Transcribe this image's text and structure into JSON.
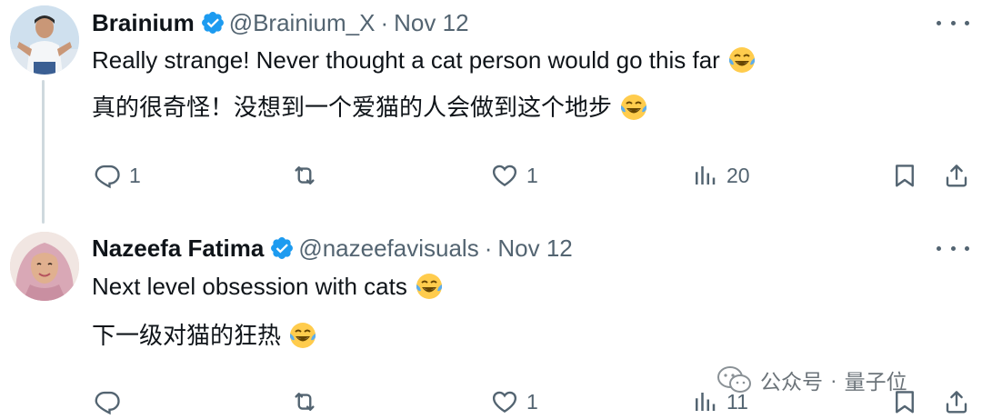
{
  "tweets": [
    {
      "author": "Brainium",
      "handle": "@Brainium_X",
      "separator": "·",
      "date": "Nov 12",
      "text_en": "Really strange! Never thought a cat person would go this far",
      "text_zh": "真的很奇怪！没想到一个爱猫的人会做到这个地步",
      "stats": {
        "replies": "1",
        "retweets": "",
        "likes": "1",
        "views": "20"
      }
    },
    {
      "author": "Nazeefa Fatima",
      "handle": "@nazeefavisuals",
      "separator": "·",
      "date": "Nov 12",
      "text_en": "Next level obsession with cats",
      "text_zh": "下一级对猫的狂热",
      "stats": {
        "replies": "",
        "retweets": "",
        "likes": "1",
        "views": "11"
      }
    }
  ],
  "watermark": {
    "source": "公众号",
    "separator": "·",
    "account": "量子位"
  },
  "icons": {
    "verified": "verified-badge-icon",
    "more": "more-options-icon",
    "reply": "reply-icon",
    "retweet": "retweet-icon",
    "like": "heart-icon",
    "views": "views-icon",
    "bookmark": "bookmark-icon",
    "share": "share-icon",
    "emoji": "face-with-tears-of-joy-emoji"
  },
  "colors": {
    "verified": "#1d9bf0",
    "text": "#0f1419",
    "secondary": "#536471",
    "thread_line": "#cfd9de"
  }
}
